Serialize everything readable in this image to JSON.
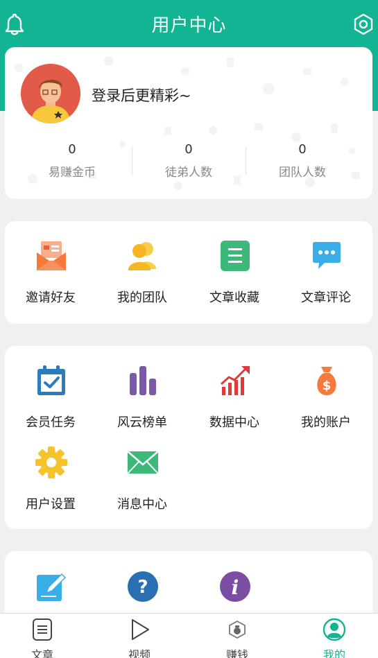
{
  "header": {
    "title": "用户中心",
    "bell_icon": "bell-icon",
    "settings_icon": "settings-hexagon-icon"
  },
  "profile": {
    "login_prompt": "登录后更精彩~",
    "stats": [
      {
        "value": "0",
        "label": "易赚金币"
      },
      {
        "value": "0",
        "label": "徒弟人数"
      },
      {
        "value": "0",
        "label": "团队人数"
      }
    ]
  },
  "menu1": [
    {
      "label": "邀请好友",
      "icon": "invite-envelope-icon",
      "color": "#f47a3d"
    },
    {
      "label": "我的团队",
      "icon": "team-users-icon",
      "color": "#f7c02c"
    },
    {
      "label": "文章收藏",
      "icon": "document-collect-icon",
      "color": "#3cb878"
    },
    {
      "label": "文章评论",
      "icon": "comment-bubble-icon",
      "color": "#3aaee8"
    }
  ],
  "menu2": [
    {
      "label": "会员任务",
      "icon": "calendar-check-icon",
      "color": "#2b7bbf"
    },
    {
      "label": "风云榜单",
      "icon": "bar-rank-icon",
      "color": "#7b58a8"
    },
    {
      "label": "数据中心",
      "icon": "growth-chart-icon",
      "color": "#e2383a"
    },
    {
      "label": "我的账户",
      "icon": "money-bag-icon",
      "color": "#f47a3d"
    },
    {
      "label": "用户设置",
      "icon": "gear-icon",
      "color": "#f7c32c"
    },
    {
      "label": "消息中心",
      "icon": "mail-icon",
      "color": "#3cb878"
    }
  ],
  "menu3": [
    {
      "icon": "edit-pencil-icon",
      "color": "#3aaee8"
    },
    {
      "icon": "help-question-icon",
      "color": "#2b6fb2"
    },
    {
      "icon": "info-icon",
      "color": "#7b4ea4"
    }
  ],
  "tabbar": [
    {
      "label": "文章",
      "icon": "article-icon",
      "active": false
    },
    {
      "label": "视频",
      "icon": "play-icon",
      "active": false
    },
    {
      "label": "赚钱",
      "icon": "money-shield-icon",
      "active": false
    },
    {
      "label": "我的",
      "icon": "user-circle-icon",
      "active": true
    }
  ],
  "colors": {
    "brand": "#12b494"
  }
}
